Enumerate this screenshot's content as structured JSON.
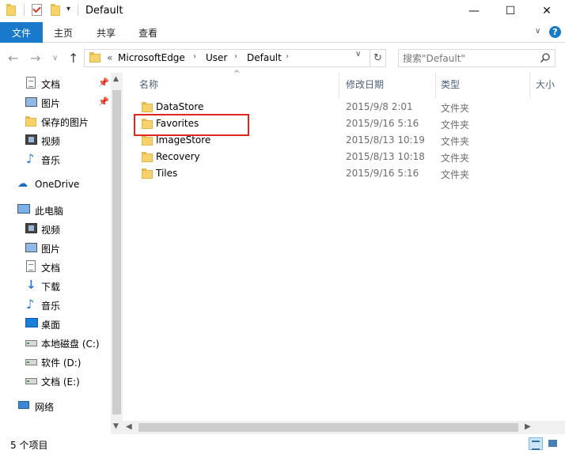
{
  "window": {
    "title": "Default",
    "minimize": "—",
    "maximize": "☐",
    "close": "✕",
    "quick_access_dropdown": "▾"
  },
  "ribbon": {
    "file_tab": "文件",
    "tabs": [
      "主页",
      "共享",
      "查看"
    ],
    "collapse": "∨",
    "help": "?"
  },
  "nav": {
    "back": "←",
    "forward": "→",
    "recent": "∨",
    "up": "↑"
  },
  "address": {
    "overflow": "«",
    "crumbs": [
      "MicrosoftEdge",
      "User",
      "Default"
    ],
    "separator": "›",
    "dropdown": "∨",
    "refresh": "↻"
  },
  "search": {
    "placeholder": "搜索\"Default\""
  },
  "sidebar": {
    "quick_items": [
      {
        "label": "文档",
        "icon": "document-icon",
        "pinned": true
      },
      {
        "label": "图片",
        "icon": "pictures-icon",
        "pinned": true
      },
      {
        "label": "保存的图片",
        "icon": "folder-icon",
        "pinned": false
      },
      {
        "label": "视频",
        "icon": "video-icon",
        "pinned": false
      },
      {
        "label": "音乐",
        "icon": "music-icon",
        "pinned": false
      }
    ],
    "pin_glyph": "📌",
    "onedrive": "OneDrive",
    "this_pc": "此电脑",
    "pc_items": [
      {
        "label": "视频",
        "icon": "video-icon"
      },
      {
        "label": "图片",
        "icon": "pictures-icon"
      },
      {
        "label": "文档",
        "icon": "document-icon"
      },
      {
        "label": "下载",
        "icon": "download-icon"
      },
      {
        "label": "音乐",
        "icon": "music-icon"
      },
      {
        "label": "桌面",
        "icon": "desktop-icon"
      },
      {
        "label": "本地磁盘 (C:)",
        "icon": "drive-icon"
      },
      {
        "label": "软件 (D:)",
        "icon": "drive-icon"
      },
      {
        "label": "文档 (E:)",
        "icon": "drive-icon"
      }
    ],
    "network": "网络",
    "scroll_up": "▲",
    "scroll_down": "▼"
  },
  "columns": {
    "name": "名称",
    "date": "修改日期",
    "type": "类型",
    "size": "大小",
    "sort_indicator": "^"
  },
  "files": [
    {
      "name": "DataStore",
      "date": "2015/9/8 2:01",
      "type": "文件夹"
    },
    {
      "name": "Favorites",
      "date": "2015/9/16 5:16",
      "type": "文件夹",
      "highlighted": true
    },
    {
      "name": "ImageStore",
      "date": "2015/8/13 10:19",
      "type": "文件夹"
    },
    {
      "name": "Recovery",
      "date": "2015/8/13 10:18",
      "type": "文件夹"
    },
    {
      "name": "Tiles",
      "date": "2015/9/16 5:16",
      "type": "文件夹"
    }
  ],
  "hscroll": {
    "left": "◀",
    "right": "▶"
  },
  "status": {
    "item_count": "5 个项目"
  },
  "colors": {
    "accent": "#1979ca",
    "highlight_box": "#e0261d",
    "folder": "#f7d16a"
  }
}
